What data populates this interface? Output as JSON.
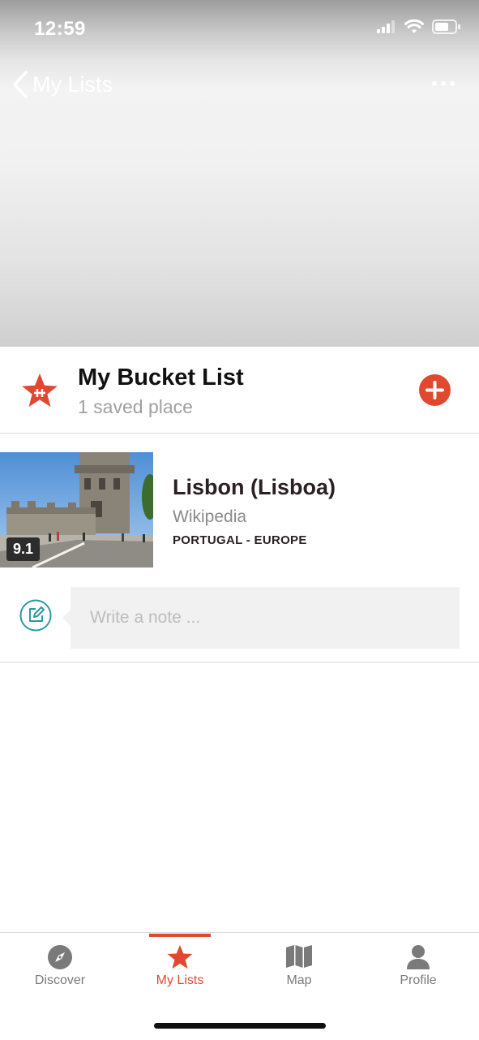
{
  "status_bar": {
    "time": "12:59"
  },
  "nav": {
    "back_label": "My Lists"
  },
  "list": {
    "title": "My Bucket List",
    "count_label": "1 saved place"
  },
  "places": [
    {
      "name": "Lisbon (Lisboa)",
      "source": "Wikipedia",
      "location": "PORTUGAL - EUROPE",
      "score": "9.1"
    }
  ],
  "note": {
    "placeholder": "Write a note ..."
  },
  "tabs": [
    {
      "label": "Discover",
      "icon": "compass-icon",
      "active": false
    },
    {
      "label": "My Lists",
      "icon": "star-icon",
      "active": true
    },
    {
      "label": "Map",
      "icon": "map-icon",
      "active": false
    },
    {
      "label": "Profile",
      "icon": "person-icon",
      "active": false
    }
  ],
  "colors": {
    "accent": "#e0492f",
    "note_icon": "#2a9aa6",
    "text_dark": "#2b2025"
  }
}
